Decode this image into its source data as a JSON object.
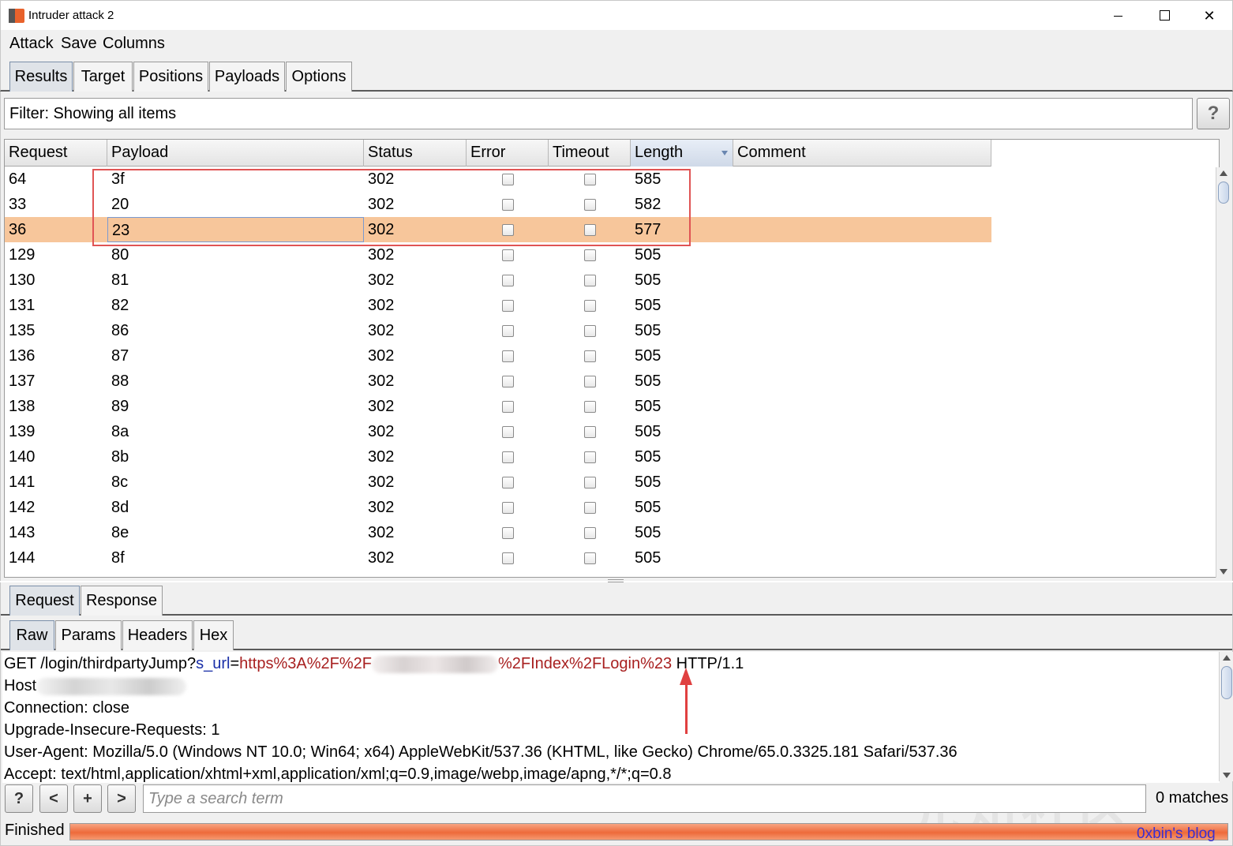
{
  "window": {
    "title": "Intruder attack 2",
    "minimize": "",
    "maximize": "",
    "close": "✕"
  },
  "menu": [
    "Attack",
    "Save",
    "Columns"
  ],
  "tabs": [
    "Results",
    "Target",
    "Positions",
    "Payloads",
    "Options"
  ],
  "active_tab": "Results",
  "filter": {
    "text": "Filter: Showing all items",
    "help": "?"
  },
  "table": {
    "columns": [
      "Request",
      "Payload",
      "Status",
      "Error",
      "Timeout",
      "Length",
      "Comment"
    ],
    "sorted_column": "Length",
    "selected_request": "36",
    "rows": [
      {
        "request": "64",
        "payload": "3f",
        "status": "302",
        "error": false,
        "timeout": false,
        "length": "585",
        "comment": ""
      },
      {
        "request": "33",
        "payload": "20",
        "status": "302",
        "error": false,
        "timeout": false,
        "length": "582",
        "comment": ""
      },
      {
        "request": "36",
        "payload": "23",
        "status": "302",
        "error": false,
        "timeout": false,
        "length": "577",
        "comment": ""
      },
      {
        "request": "129",
        "payload": "80",
        "status": "302",
        "error": false,
        "timeout": false,
        "length": "505",
        "comment": ""
      },
      {
        "request": "130",
        "payload": "81",
        "status": "302",
        "error": false,
        "timeout": false,
        "length": "505",
        "comment": ""
      },
      {
        "request": "131",
        "payload": "82",
        "status": "302",
        "error": false,
        "timeout": false,
        "length": "505",
        "comment": ""
      },
      {
        "request": "135",
        "payload": "86",
        "status": "302",
        "error": false,
        "timeout": false,
        "length": "505",
        "comment": ""
      },
      {
        "request": "136",
        "payload": "87",
        "status": "302",
        "error": false,
        "timeout": false,
        "length": "505",
        "comment": ""
      },
      {
        "request": "137",
        "payload": "88",
        "status": "302",
        "error": false,
        "timeout": false,
        "length": "505",
        "comment": ""
      },
      {
        "request": "138",
        "payload": "89",
        "status": "302",
        "error": false,
        "timeout": false,
        "length": "505",
        "comment": ""
      },
      {
        "request": "139",
        "payload": "8a",
        "status": "302",
        "error": false,
        "timeout": false,
        "length": "505",
        "comment": ""
      },
      {
        "request": "140",
        "payload": "8b",
        "status": "302",
        "error": false,
        "timeout": false,
        "length": "505",
        "comment": ""
      },
      {
        "request": "141",
        "payload": "8c",
        "status": "302",
        "error": false,
        "timeout": false,
        "length": "505",
        "comment": ""
      },
      {
        "request": "142",
        "payload": "8d",
        "status": "302",
        "error": false,
        "timeout": false,
        "length": "505",
        "comment": ""
      },
      {
        "request": "143",
        "payload": "8e",
        "status": "302",
        "error": false,
        "timeout": false,
        "length": "505",
        "comment": ""
      },
      {
        "request": "144",
        "payload": "8f",
        "status": "302",
        "error": false,
        "timeout": false,
        "length": "505",
        "comment": ""
      }
    ]
  },
  "message_tabs": [
    "Request",
    "Response"
  ],
  "active_message_tab": "Request",
  "view_tabs": [
    "Raw",
    "Params",
    "Headers",
    "Hex"
  ],
  "active_view_tab": "Raw",
  "raw_request": {
    "line1": {
      "prefix": "GET /login/thirdpartyJump?",
      "param": "s_url",
      "eq": "=",
      "value_start": "https%3A%2F%2F",
      "value_end": "%2FIndex%2FLogin%23",
      "suffix": " HTTP/1.1"
    },
    "host_label": "Host",
    "lines": [
      "Connection: close",
      "Upgrade-Insecure-Requests: 1",
      "User-Agent: Mozilla/5.0 (Windows NT 10.0; Win64; x64) AppleWebKit/537.36 (KHTML, like Gecko) Chrome/65.0.3325.181 Safari/537.36",
      "Accept: text/html,application/xhtml+xml,application/xml;q=0.9,image/webp,image/apng,*/*;q=0.8"
    ]
  },
  "search": {
    "help": "?",
    "prev": "<",
    "add": "+",
    "next": ">",
    "placeholder": "Type a search term",
    "matches": "0 matches"
  },
  "status": {
    "text": "Finished",
    "progress": 1.0
  },
  "blog": "0xbin's blog",
  "watermark": "先知社区"
}
